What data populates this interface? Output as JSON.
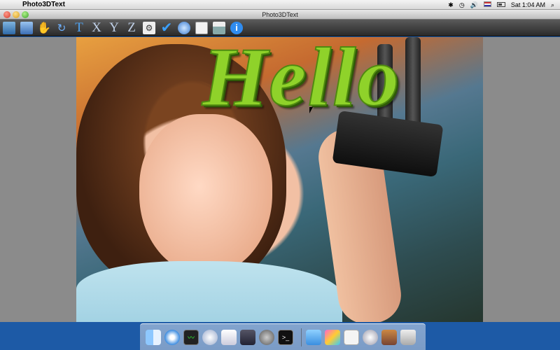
{
  "menubar": {
    "app_name": "Photo3DText",
    "clock": "Sat 1:04 AM",
    "status_icons": [
      "bluetooth-icon",
      "time-machine-icon",
      "volume-icon",
      "flag-icon",
      "battery-icon",
      "spotlight-icon"
    ]
  },
  "window": {
    "title": "Photo3DText"
  },
  "toolbar": {
    "items": [
      "open-image-icon",
      "save-icon",
      "hand-tool-icon",
      "rotate-icon",
      "text-icon",
      "x-axis-icon",
      "y-axis-icon",
      "z-axis-icon",
      "settings-icon",
      "check-icon",
      "preview-icon",
      "document-icon",
      "print-icon",
      "info-icon"
    ],
    "letters": {
      "t": "T",
      "x": "X",
      "y": "Y",
      "z": "Z"
    }
  },
  "canvas": {
    "text": "Hello",
    "text_color": "#8fd22a"
  },
  "dock": {
    "items": [
      "finder-icon",
      "safari-icon",
      "activity-monitor-icon",
      "network-icon",
      "app-icon",
      "app-icon-2",
      "app-icon-3",
      "terminal-icon",
      "folder-icon",
      "app-icon-4",
      "app-icon-5",
      "app-icon-6",
      "app-icon-7",
      "trash-icon"
    ]
  }
}
